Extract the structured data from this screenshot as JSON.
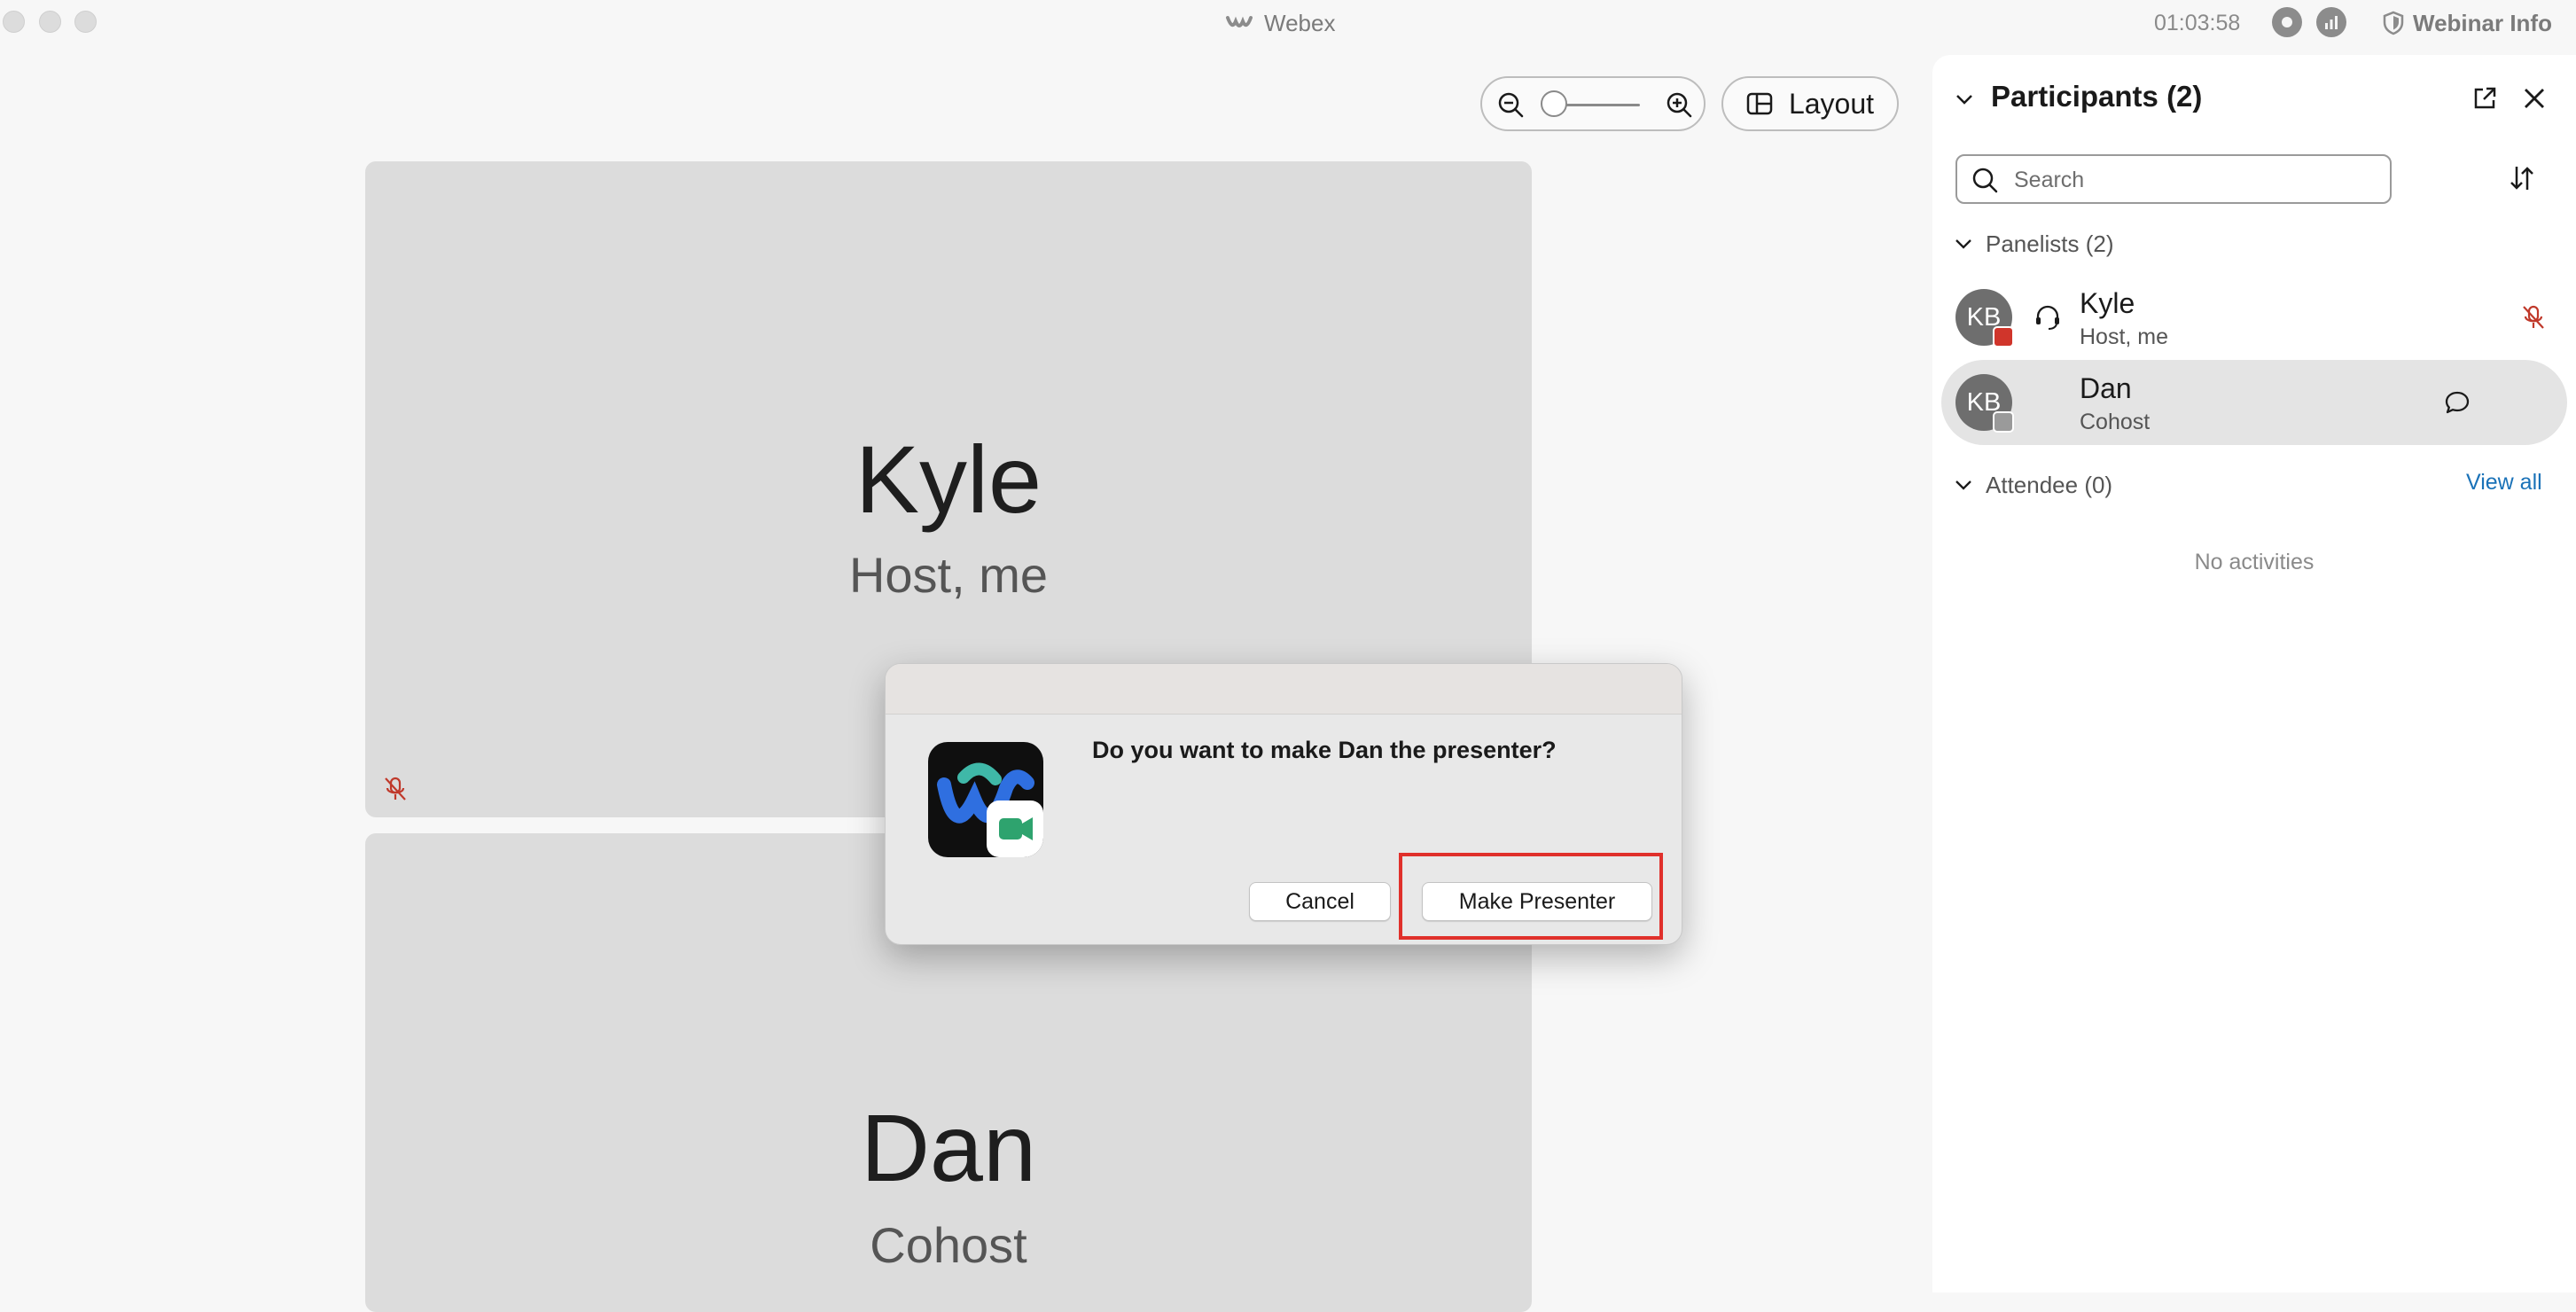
{
  "window": {
    "title": "Webex",
    "clock": "01:03:58",
    "webinar_info": "Webinar Info"
  },
  "toolbar": {
    "layout_label": "Layout",
    "zoom_level": 0.1
  },
  "stage": {
    "tiles": [
      {
        "name": "Kyle",
        "role": "Host, me"
      },
      {
        "name": "Dan",
        "role": "Cohost"
      }
    ]
  },
  "dialog": {
    "message": "Do you want to make Dan the presenter?",
    "cancel_label": "Cancel",
    "confirm_label": "Make Presenter"
  },
  "panel": {
    "title": "Participants (2)",
    "search_placeholder": "Search",
    "panelists_label": "Panelists (2)",
    "attendee_label": "Attendee (0)",
    "view_all_label": "View all",
    "no_activities": "No activities",
    "participants": [
      {
        "initials": "KB",
        "name": "Kyle",
        "role": "Host, me"
      },
      {
        "initials": "KB",
        "name": "Dan",
        "role": "Cohost"
      }
    ]
  },
  "colors": {
    "accent_red": "#e0302b",
    "link_blue": "#1a72b8",
    "mute_red": "#c0392b"
  },
  "icons": [
    "zoom-out-icon",
    "zoom-in-icon",
    "layout-grid-icon",
    "record-icon",
    "stats-icon",
    "shield-icon",
    "chevron-down-icon",
    "popout-icon",
    "close-icon",
    "search-icon",
    "sort-icon",
    "headset-icon",
    "muted-mic-icon",
    "chat-icon",
    "webex-app-icon"
  ]
}
